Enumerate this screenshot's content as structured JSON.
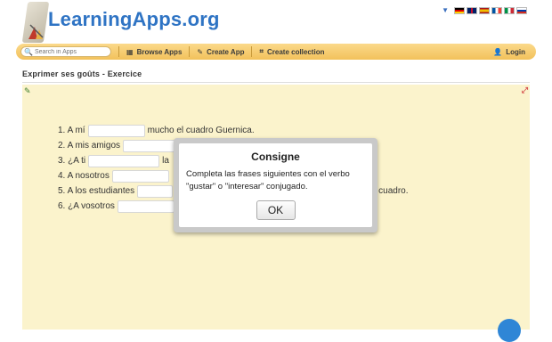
{
  "header": {
    "logo_text": "LearningApps.org",
    "flags": [
      {
        "name": "german-flag",
        "colors": [
          "#000000",
          "#dd0000",
          "#ffce00"
        ]
      },
      {
        "name": "uk-flag",
        "colors": [
          "#012169",
          "#ffffff",
          "#c8102e"
        ]
      },
      {
        "name": "spanish-flag",
        "colors": [
          "#aa151b",
          "#f1bf00",
          "#aa151b"
        ]
      },
      {
        "name": "french-flag",
        "colors": [
          "#0055a4",
          "#ffffff",
          "#ef4135"
        ]
      },
      {
        "name": "italian-flag",
        "colors": [
          "#009246",
          "#ffffff",
          "#ce2b37"
        ]
      },
      {
        "name": "russian-flag",
        "colors": [
          "#ffffff",
          "#0039a6",
          "#d52b1e"
        ]
      }
    ]
  },
  "nav": {
    "search_placeholder": "Search in Apps",
    "browse_label": "Browse Apps",
    "create_app_label": "Create App",
    "create_collection_label": "Create collection",
    "login_label": "Login"
  },
  "page": {
    "title": "Exprimer ses goûts - Exercice"
  },
  "exercise": {
    "sentences": [
      {
        "prefix": "1. A mí",
        "suffix": "mucho el cuadro Guernica."
      },
      {
        "prefix": "2. A mis amigos",
        "suffix": ""
      },
      {
        "prefix": "3. ¿A ti",
        "suffix": "la"
      },
      {
        "prefix": "4. A nosotros",
        "suffix": ""
      },
      {
        "prefix": "5. A los estudiantes",
        "suffix": "cuadro."
      },
      {
        "prefix": "6. ¿A vosotros",
        "suffix": ""
      }
    ]
  },
  "modal": {
    "title": "Consigne",
    "text": "Completa las frases siguientes con el verbo \"gustar\" o \"interesar\" conjugado.",
    "ok_label": "OK"
  },
  "colors": {
    "nav_bg": "#f2c15b",
    "logo_blue": "#2f74c4",
    "exercise_bg": "#fbf3cc"
  }
}
